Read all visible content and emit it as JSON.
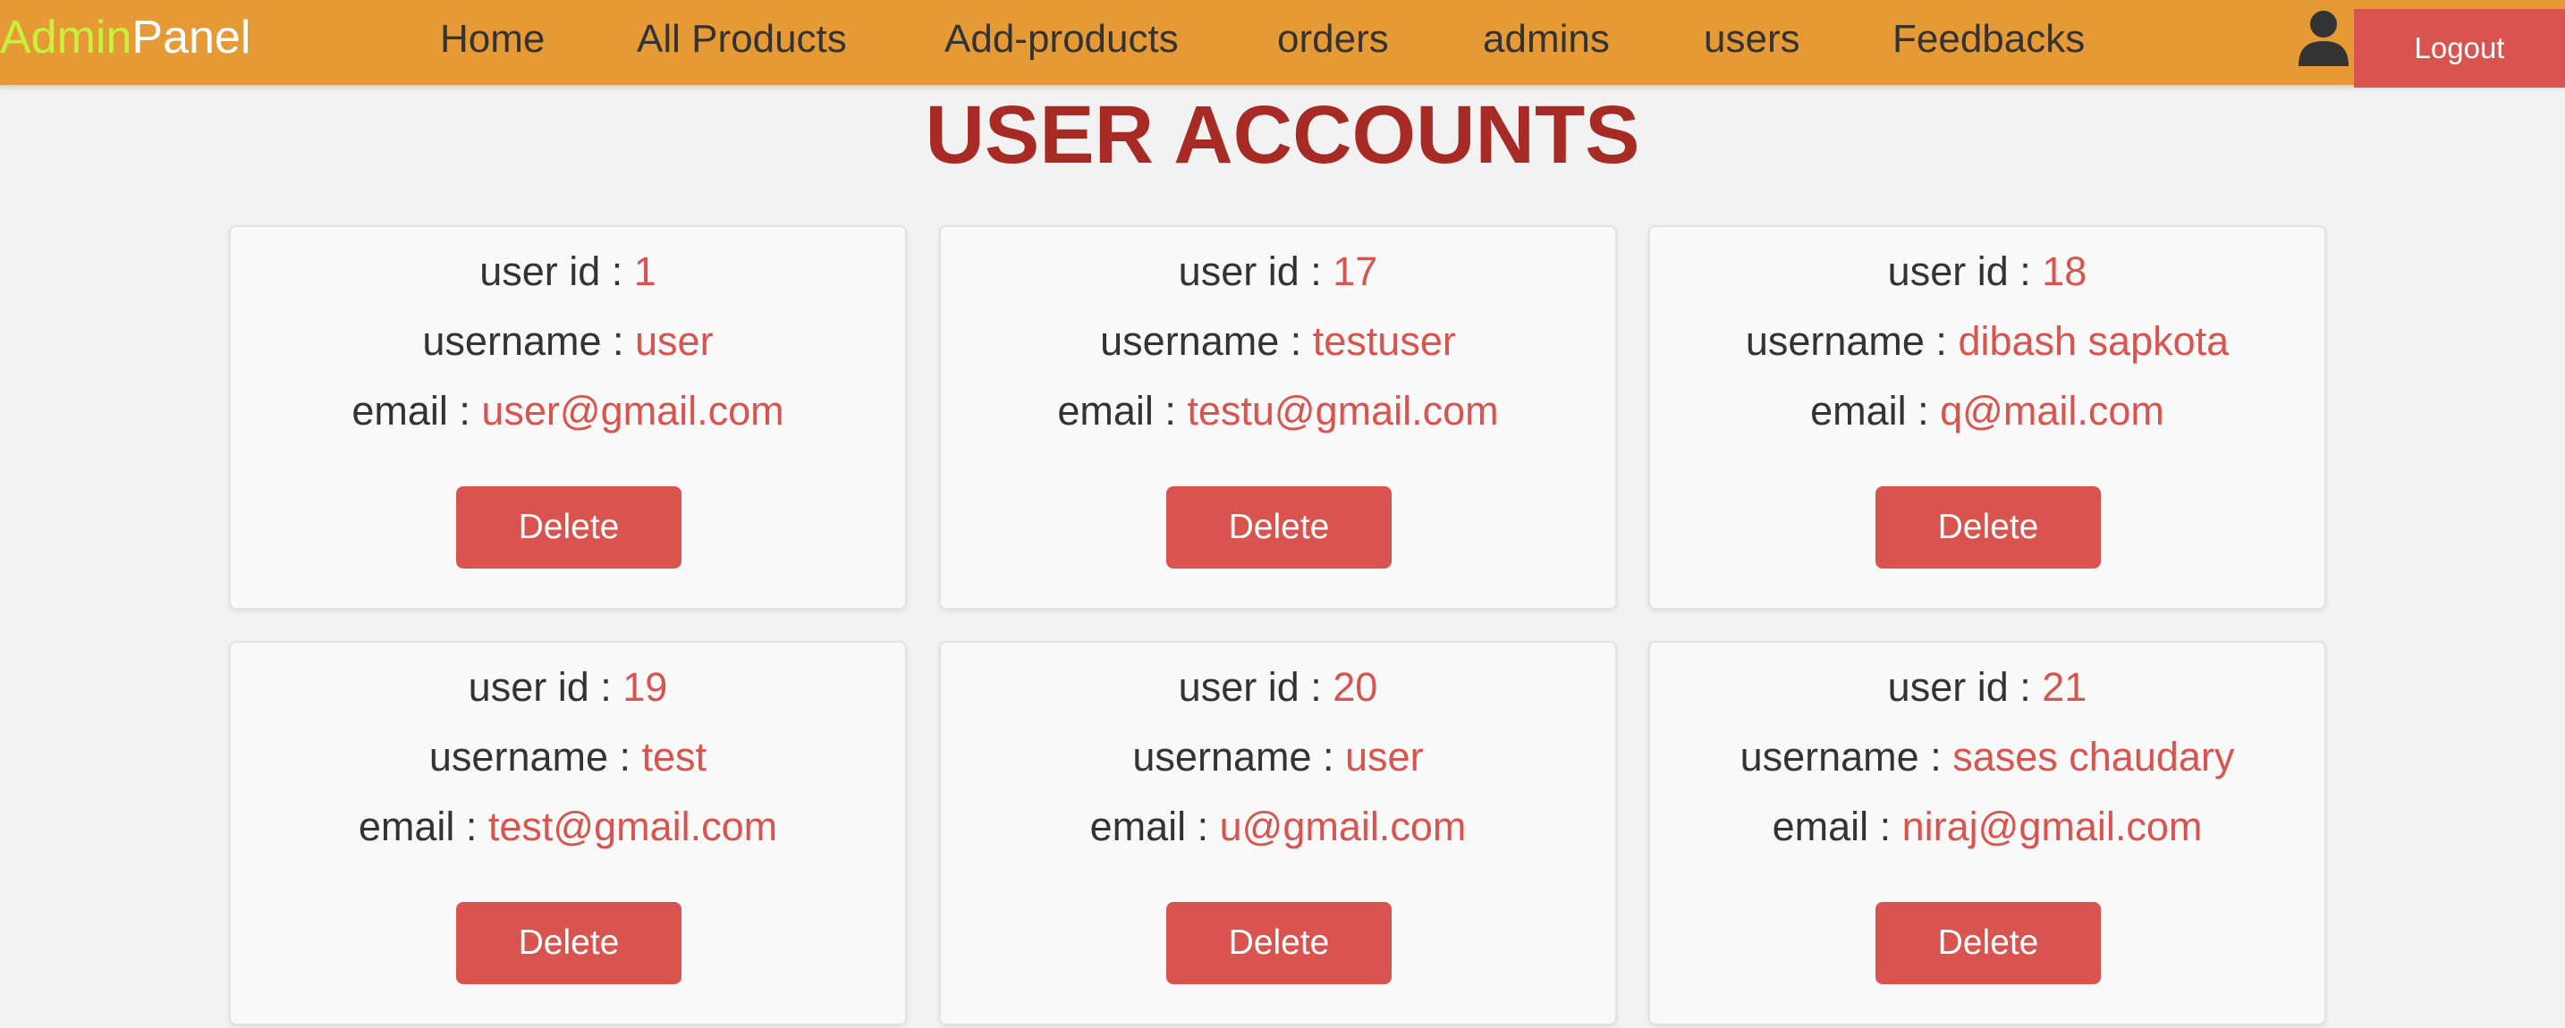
{
  "header": {
    "logo_part1": "Admin",
    "logo_part2": "Panel",
    "nav": [
      "Home",
      "All Products",
      "Add-products",
      "orders",
      "admins",
      "users",
      "Feedbacks"
    ],
    "user_icon": "user-icon",
    "logout_label": "Logout"
  },
  "page": {
    "title": "USER ACCOUNTS"
  },
  "labels": {
    "user_id": "user id : ",
    "username": "username : ",
    "email": "email : ",
    "delete": "Delete"
  },
  "users": [
    {
      "id": "1",
      "username": "user",
      "email": "user@gmail.com"
    },
    {
      "id": "17",
      "username": "testuser",
      "email": "testu@gmail.com"
    },
    {
      "id": "18",
      "username": "dibash sapkota",
      "email": "q@mail.com"
    },
    {
      "id": "19",
      "username": "test",
      "email": "test@gmail.com"
    },
    {
      "id": "20",
      "username": "user",
      "email": "u@gmail.com"
    },
    {
      "id": "21",
      "username": "sases chaudary",
      "email": "niraj@gmail.com"
    }
  ],
  "colors": {
    "header_bg": "#e69a35",
    "logo_accent": "#c7f23b",
    "title": "#a82a25",
    "accent": "#d9534f"
  }
}
